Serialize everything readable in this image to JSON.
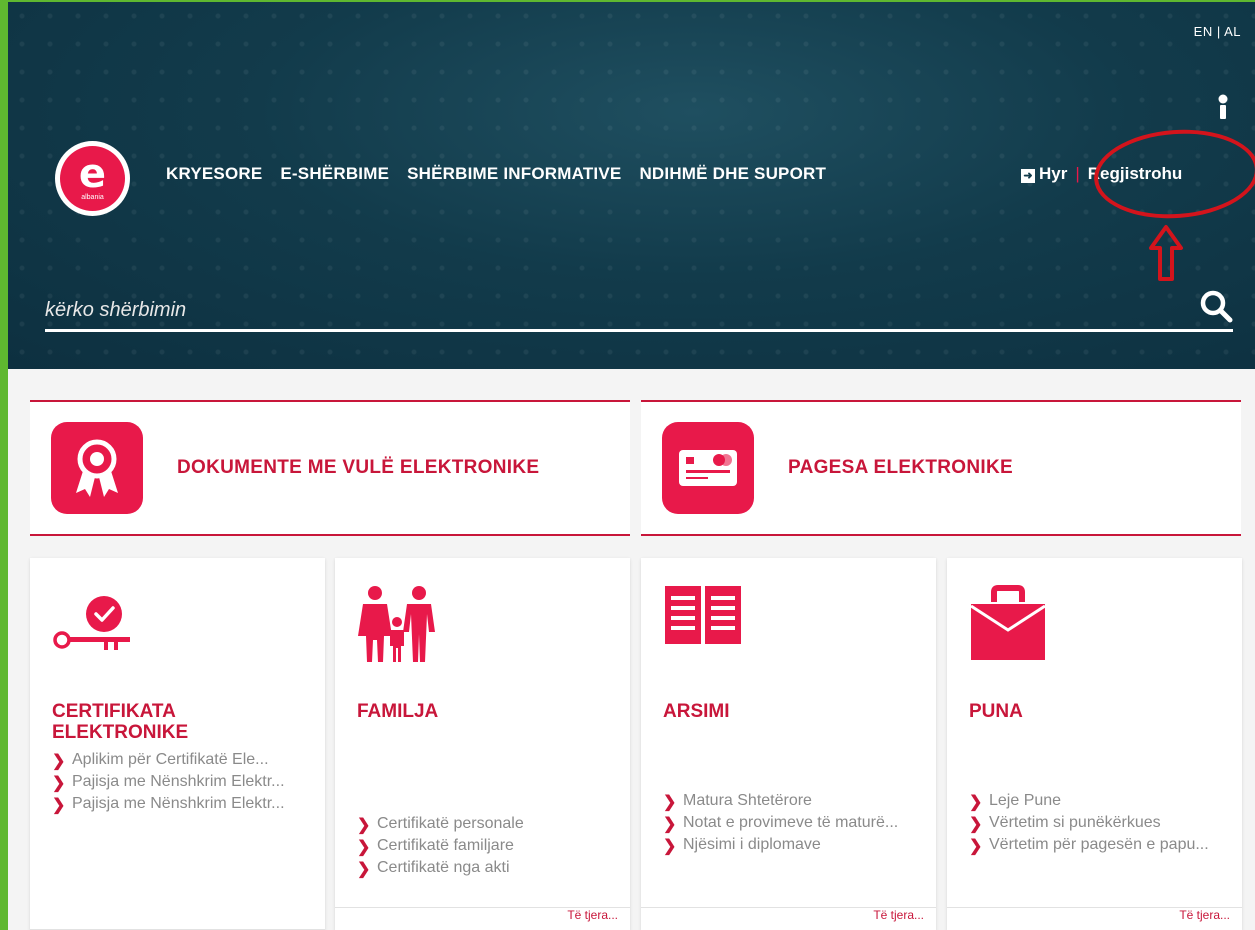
{
  "header": {
    "language": "EN | AL",
    "logo_text": "albania",
    "logo_letter": "e",
    "nav": [
      "KRYESORE",
      "E-SHËRBIME",
      "SHËRBIME INFORMATIVE",
      "NDIHMË DHE SUPORT"
    ],
    "login_label": "Hyr",
    "separator": "|",
    "register_label": "Regjistrohu"
  },
  "search": {
    "placeholder": "kërko shërbimin"
  },
  "features": [
    {
      "label": "DOKUMENTE ME VULË ELEKTRONIKE",
      "icon": "award-ribbon-icon"
    },
    {
      "label": "PAGESA ELEKTRONIKE",
      "icon": "credit-card-icon"
    }
  ],
  "categories": [
    {
      "title": "CERTIFIKATA ELEKTRONIKE",
      "icon": "key-check-icon",
      "items": [
        "Aplikim për Certifikatë Ele...",
        "Pajisja me Nënshkrim Elektr...",
        "Pajisja me Nënshkrim Elektr..."
      ],
      "more": ""
    },
    {
      "title": "FAMILJA",
      "icon": "family-icon",
      "items": [
        "Certifikatë personale",
        "Certifikatë familjare",
        "Certifikatë nga akti"
      ],
      "more": "Të tjera..."
    },
    {
      "title": "ARSIMI",
      "icon": "open-book-icon",
      "items": [
        "Matura Shtetërore",
        "Notat e provimeve të maturë...",
        "Njësimi i diplomave"
      ],
      "more": "Të tjera..."
    },
    {
      "title": "PUNA",
      "icon": "briefcase-icon",
      "items": [
        "Leje Pune",
        "Vërtetim si punëkërkues",
        "Vërtetim për pagesën e papu..."
      ],
      "more": "Të tjera..."
    }
  ],
  "colors": {
    "header_bg": "#123b4b",
    "accent": "#e8194a",
    "accent_text": "#c8163a",
    "annotation": "#d3141c"
  }
}
